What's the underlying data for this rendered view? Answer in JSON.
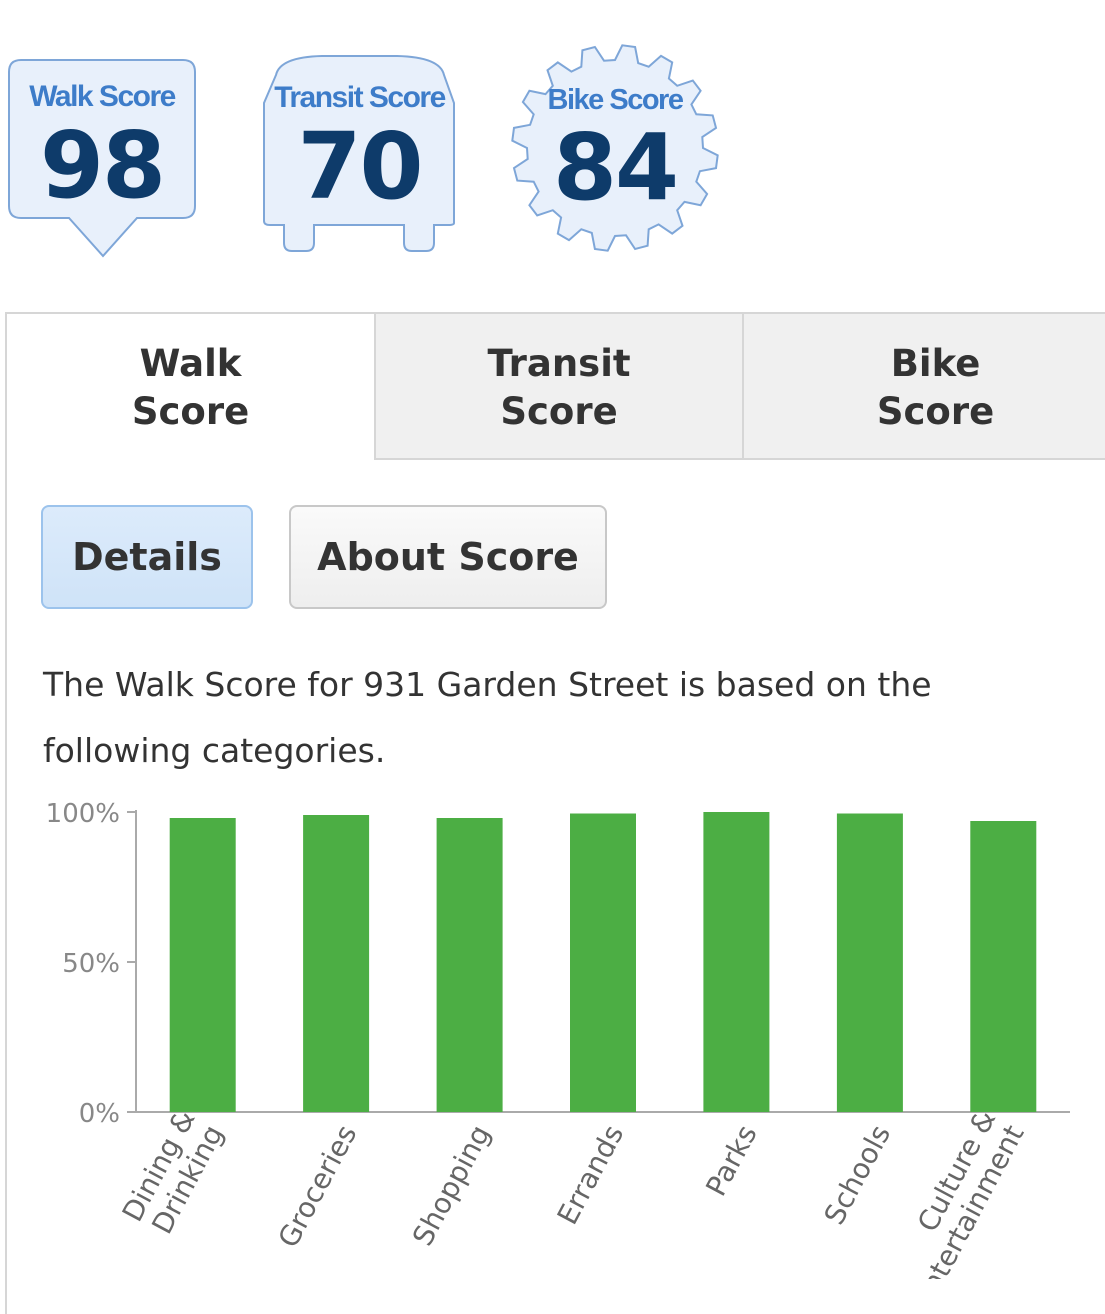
{
  "badges": {
    "walk": {
      "label": "Walk Score",
      "value": "98"
    },
    "transit": {
      "label": "Transit Score",
      "value": "70"
    },
    "bike": {
      "label": "Bike Score",
      "value": "84"
    }
  },
  "tabs": [
    {
      "line1": "Walk",
      "line2": "Score",
      "active": true
    },
    {
      "line1": "Transit",
      "line2": "Score",
      "active": false
    },
    {
      "line1": "Bike",
      "line2": "Score",
      "active": false
    }
  ],
  "subtabs": {
    "details": "Details",
    "about": "About Score"
  },
  "description": "The Walk Score for 931 Garden Street is based on the following categories.",
  "colors": {
    "badge_fill": "#e8f0fb",
    "badge_stroke": "#7ea6d8",
    "bar": "#4cae44",
    "title_blue": "#3d7cc9",
    "number_navy": "#0e3b6a"
  },
  "chart_data": {
    "type": "bar",
    "categories": [
      "Dining &\nDrinking",
      "Groceries",
      "Shopping",
      "Errands",
      "Parks",
      "Schools",
      "Culture &\nEntertainment"
    ],
    "values": [
      98,
      99,
      98,
      99.5,
      100,
      99.5,
      97
    ],
    "ylim": [
      0,
      100
    ],
    "yticks": [
      "0%",
      "50%",
      "100%"
    ],
    "grid": false
  }
}
